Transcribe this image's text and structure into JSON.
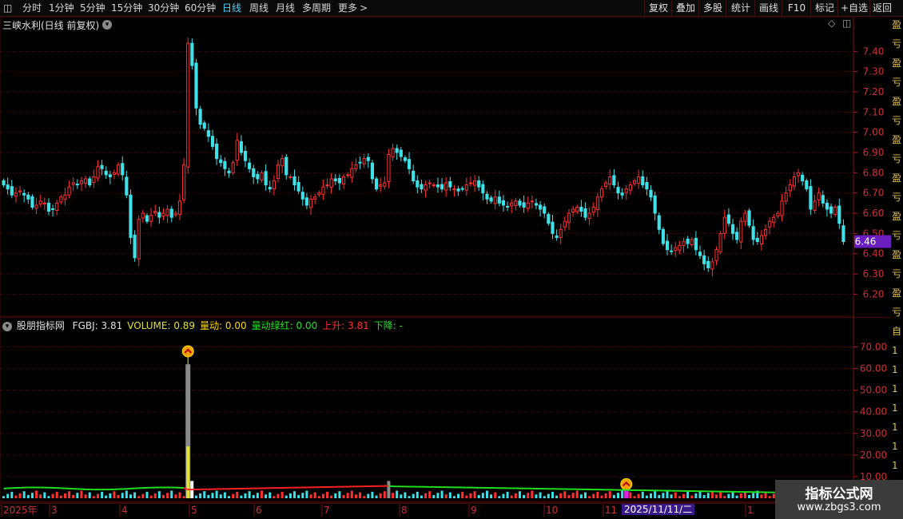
{
  "toolbar": {
    "periods": [
      "分时",
      "1分钟",
      "5分钟",
      "15分钟",
      "30分钟",
      "60分钟",
      "日线",
      "周线",
      "月线",
      "多周期",
      "更多"
    ],
    "active_period": "日线",
    "right_buttons": [
      "复权",
      "叠加",
      "多股",
      "统计",
      "画线",
      "F10",
      "标记",
      "+自选",
      "返回"
    ]
  },
  "main": {
    "title": "三峡水利(日线 前复权)",
    "price_ticks": [
      "7.40",
      "7.30",
      "7.20",
      "7.10",
      "7.00",
      "6.90",
      "6.80",
      "6.70",
      "6.60",
      "6.50",
      "6.40",
      "6.30",
      "6.20"
    ],
    "last_price": "6.46",
    "last_price_color": "#6a1ec0"
  },
  "indicator": {
    "name": "股朋指标网",
    "items": [
      {
        "label": "FGBJ: 3.81",
        "color": "#e0e0e0"
      },
      {
        "label": "VOLUME: 0.89",
        "color": "#e0e040"
      },
      {
        "label": "量动: 0.00",
        "color": "#ffd700"
      },
      {
        "label": "量动绿红: 0.00",
        "color": "#20e020"
      },
      {
        "label": "上升: 3.81",
        "color": "#ff3030"
      },
      {
        "label": "下降: -",
        "color": "#20e020"
      }
    ],
    "y_ticks": [
      "70.00",
      "60.00",
      "50.00",
      "40.00",
      "30.00",
      "20.00",
      "10.00"
    ]
  },
  "xaxis": {
    "labels": [
      "2025年",
      "3",
      "4",
      "5",
      "6",
      "7",
      "8",
      "9",
      "10",
      "11",
      "1"
    ],
    "cursor_date": "2025/11/11/二"
  },
  "watermark": {
    "title": "指标公式网",
    "url": "www.zbgs3.com"
  },
  "right_strip": [
    "盈",
    "亏",
    "盈",
    "亏",
    "盈",
    "亏",
    "盈",
    "亏",
    "盈",
    "亏",
    "盈",
    "亏",
    "盈",
    "亏",
    "盈",
    "亏",
    "自",
    "1",
    "1",
    "1",
    "1",
    "1",
    "1",
    "1",
    "1"
  ],
  "chart_data": {
    "type": "candlestick",
    "title": "三峡水利(日线 前复权)",
    "ylim": [
      6.17,
      7.5
    ],
    "close": [
      6.74,
      6.72,
      6.69,
      6.7,
      6.71,
      6.69,
      6.67,
      6.63,
      6.64,
      6.66,
      6.65,
      6.61,
      6.62,
      6.65,
      6.68,
      6.69,
      6.73,
      6.75,
      6.74,
      6.76,
      6.77,
      6.74,
      6.78,
      6.83,
      6.82,
      6.79,
      6.78,
      6.8,
      6.84,
      6.79,
      6.69,
      6.48,
      6.38,
      6.57,
      6.6,
      6.56,
      6.59,
      6.61,
      6.58,
      6.6,
      6.62,
      6.58,
      6.6,
      6.66,
      6.84,
      7.44,
      7.33,
      7.12,
      7.04,
      7.02,
      6.98,
      6.93,
      6.87,
      6.85,
      6.82,
      6.8,
      6.85,
      6.96,
      6.9,
      6.86,
      6.82,
      6.78,
      6.77,
      6.8,
      6.74,
      6.72,
      6.76,
      6.84,
      6.87,
      6.79,
      6.78,
      6.74,
      6.71,
      6.67,
      6.64,
      6.67,
      6.68,
      6.7,
      6.73,
      6.74,
      6.77,
      6.76,
      6.75,
      6.78,
      6.79,
      6.82,
      6.84,
      6.85,
      6.87,
      6.86,
      6.77,
      6.72,
      6.74,
      6.75,
      6.89,
      6.92,
      6.9,
      6.88,
      6.86,
      6.82,
      6.76,
      6.73,
      6.72,
      6.74,
      6.75,
      6.74,
      6.73,
      6.72,
      6.75,
      6.73,
      6.72,
      6.71,
      6.72,
      6.74,
      6.75,
      6.76,
      6.73,
      6.7,
      6.67,
      6.66,
      6.68,
      6.65,
      6.64,
      6.63,
      6.65,
      6.66,
      6.64,
      6.63,
      6.65,
      6.66,
      6.64,
      6.62,
      6.6,
      6.55,
      6.5,
      6.48,
      6.52,
      6.56,
      6.6,
      6.62,
      6.63,
      6.61,
      6.58,
      6.6,
      6.63,
      6.68,
      6.72,
      6.75,
      6.78,
      6.74,
      6.7,
      6.69,
      6.72,
      6.74,
      6.76,
      6.78,
      6.74,
      6.72,
      6.68,
      6.6,
      6.52,
      6.45,
      6.42,
      6.41,
      6.43,
      6.44,
      6.46,
      6.45,
      6.47,
      6.42,
      6.39,
      6.35,
      6.33,
      6.36,
      6.42,
      6.5,
      6.58,
      6.55,
      6.5,
      6.47,
      6.56,
      6.6,
      6.54,
      6.47,
      6.46,
      6.49,
      6.52,
      6.56,
      6.58,
      6.6,
      6.66,
      6.7,
      6.74,
      6.78,
      6.8,
      6.76,
      6.72,
      6.62,
      6.66,
      6.7,
      6.65,
      6.62,
      6.6,
      6.63,
      6.55,
      6.46
    ]
  }
}
